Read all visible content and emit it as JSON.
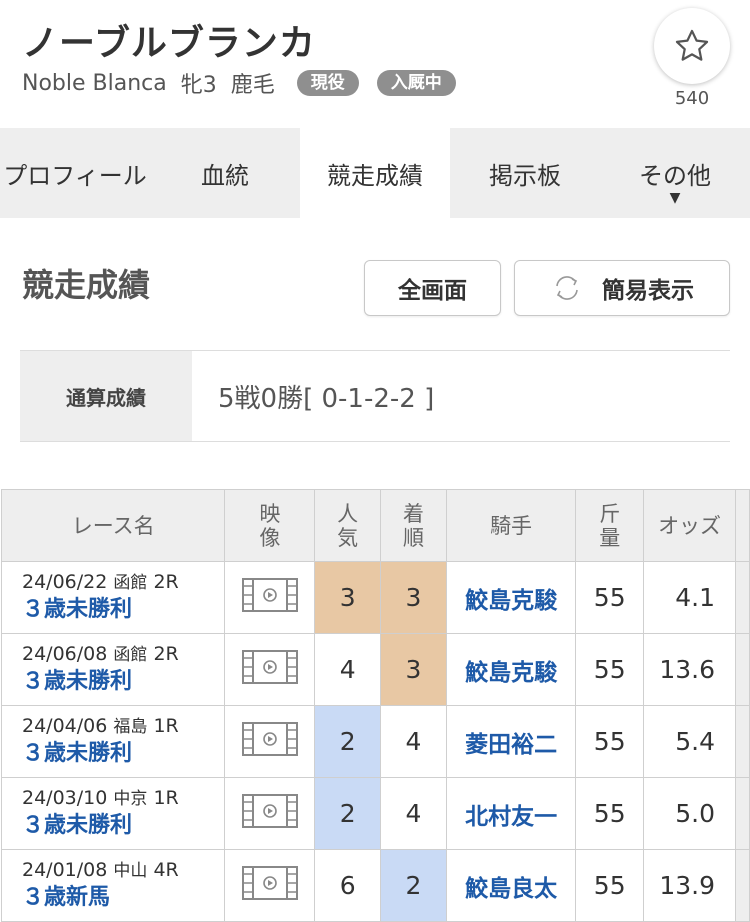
{
  "horse": {
    "name_jp": "ノーブルブランカ",
    "name_en": "Noble Blanca",
    "sex_age": "牝3",
    "coat": "鹿毛",
    "badges": [
      "現役",
      "入厩中"
    ],
    "favorite_count": "540"
  },
  "tabs": [
    {
      "label": "プロフィール"
    },
    {
      "label": "血統"
    },
    {
      "label": "競走成績"
    },
    {
      "label": "掲示板"
    },
    {
      "label": "その他",
      "caret": "▼"
    }
  ],
  "section": {
    "title": "競走成績",
    "full_button": "全画面",
    "simple_button": "簡易表示"
  },
  "summary": {
    "label": "通算成績",
    "value": "5戦0勝[ 0-1-2-2 ]"
  },
  "table": {
    "headers": {
      "race": "レース名",
      "video": "映像",
      "popularity": "人気",
      "finish": "着順",
      "jockey": "騎手",
      "weight": "斤量",
      "odds": "オッズ"
    },
    "rows": [
      {
        "date": "24/06/22",
        "venue": "函館",
        "race_no": "2R",
        "race_name": "３歳未勝利",
        "popularity": "3",
        "finish": "3",
        "jockey": "鮫島克駿",
        "weight": "55",
        "odds": "4.1"
      },
      {
        "date": "24/06/08",
        "venue": "函館",
        "race_no": "2R",
        "race_name": "３歳未勝利",
        "popularity": "4",
        "finish": "3",
        "jockey": "鮫島克駿",
        "weight": "55",
        "odds": "13.6"
      },
      {
        "date": "24/04/06",
        "venue": "福島",
        "race_no": "1R",
        "race_name": "３歳未勝利",
        "popularity": "2",
        "finish": "4",
        "jockey": "菱田裕二",
        "weight": "55",
        "odds": "5.4"
      },
      {
        "date": "24/03/10",
        "venue": "中京",
        "race_no": "1R",
        "race_name": "３歳未勝利",
        "popularity": "2",
        "finish": "4",
        "jockey": "北村友一",
        "weight": "55",
        "odds": "5.0"
      },
      {
        "date": "24/01/08",
        "venue": "中山",
        "race_no": "4R",
        "race_name": "３歳新馬",
        "popularity": "6",
        "finish": "2",
        "jockey": "鮫島良太",
        "weight": "55",
        "odds": "13.9"
      }
    ]
  },
  "colors": {
    "highlight_orange": "#e8c8a4",
    "highlight_blue": "#c9daf5",
    "link_blue": "#1e5aa8"
  }
}
